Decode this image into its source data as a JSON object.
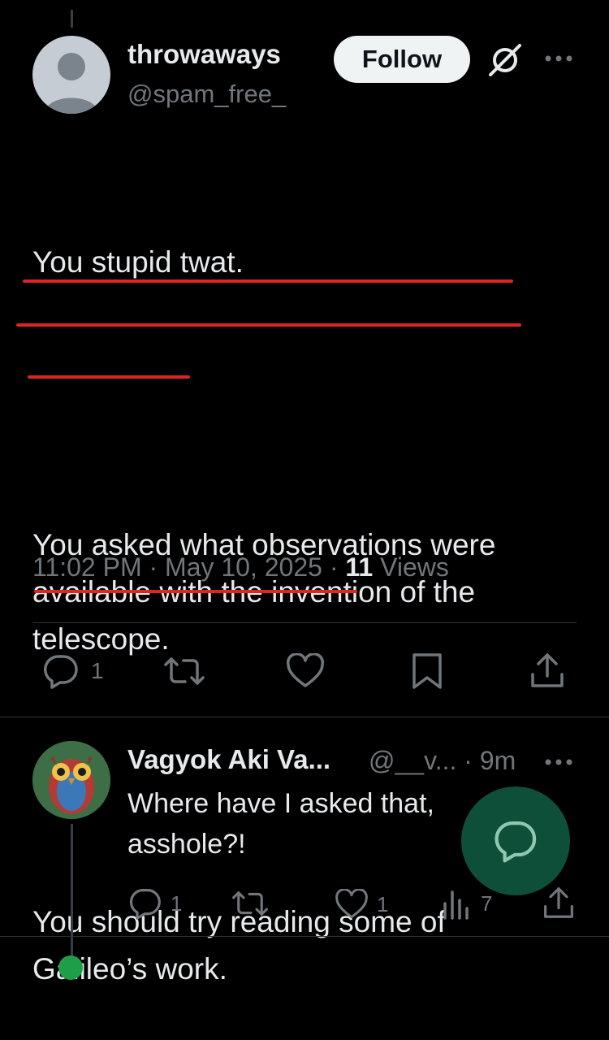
{
  "tweet": {
    "author_name": "throwaways",
    "author_handle": "@spam_free_",
    "follow_label": "Follow",
    "text_line1": "You stupid twat.",
    "text_para2": "You asked what observations were available with the invention of the telescope.",
    "text_para3": "You should try reading some of Galileo’s work.",
    "timestamp": "11:02 PM · May 10, 2025",
    "separator": " · ",
    "views_count": "11",
    "views_label": " Views",
    "reply_count": "1",
    "icons": {
      "grok": "grok-icon",
      "more": "more-icon",
      "reply": "reply-icon",
      "retweet": "retweet-icon",
      "like": "heart-icon",
      "bookmark": "bookmark-icon",
      "share": "share-icon"
    }
  },
  "reply": {
    "author_name": "Vagyok Aki Va...",
    "author_handle": "@__v... · 9m",
    "text": "Where have I asked that, asshole?!",
    "reply_count": "1",
    "like_count": "1",
    "views_count": "7"
  },
  "colors": {
    "background": "#000000",
    "text": "#e7e9ea",
    "muted": "#71767b",
    "underline": "#e0241f",
    "fab": "#146e50"
  }
}
